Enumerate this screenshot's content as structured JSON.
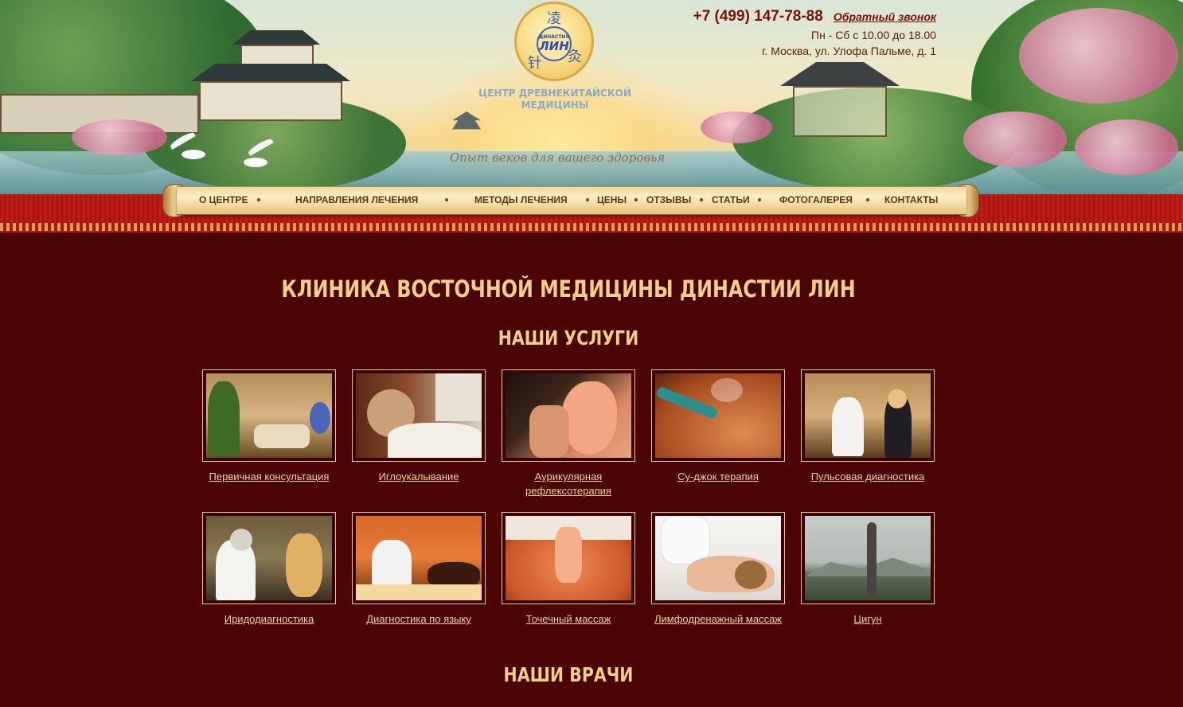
{
  "header": {
    "logo": {
      "small_text": "ДИНАСТИЯ",
      "big_text": "ЛИН",
      "glyphs": [
        "凌",
        "针",
        "灸"
      ]
    },
    "logo_caption": "ЦЕНТР ДРЕВНЕКИТАЙСКОЙ МЕДИЦИНЫ",
    "slogan": "Опыт веков для вашего здоровья",
    "phone": "+7 (499) 147-78-88",
    "callback": "Обратный звонок",
    "hours": "Пн - Сб с 10.00 до 18.00",
    "address": "г. Москва, ул. Улофа Пальме, д. 1"
  },
  "nav": {
    "items": [
      "О ЦЕНТРЕ",
      "НАПРАВЛЕНИЯ ЛЕЧЕНИЯ",
      "МЕТОДЫ ЛЕЧЕНИЯ",
      "ЦЕНЫ",
      "ОТЗЫВЫ",
      "СТАТЬИ",
      "ФОТОГАЛЕРЕЯ",
      "КОНТАКТЫ"
    ]
  },
  "main": {
    "title": "КЛИНИКА ВОСТОЧНОЙ МЕДИЦИНЫ ДИНАСТИИ ЛИН",
    "services_title": "НАШИ УСЛУГИ",
    "services": [
      "Первичная консультация",
      "Иглоукалывание",
      "Аурикулярная рефлексотерапия",
      "Су-джок терапия",
      "Пульсовая диагностика",
      "Иридодиагностика",
      "Диагностика по языку",
      "Точечный массаж",
      "Лимфодренажный массаж",
      "Цигун"
    ],
    "doctors_title": "НАШИ ВРАЧИ"
  },
  "colors": {
    "page_background": "#4a0504",
    "heading_gold": "#f2cf86",
    "link_gold": "#f2d18e",
    "phone_red": "#7a1208",
    "nav_band_red": "#a8140d"
  }
}
